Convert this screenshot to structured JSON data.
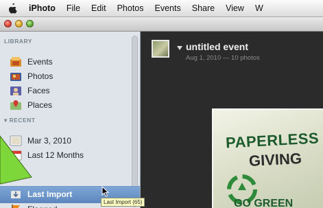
{
  "menubar": {
    "app": "iPhoto",
    "items": [
      "File",
      "Edit",
      "Photos",
      "Events",
      "Share",
      "View",
      "W"
    ]
  },
  "sidebar": {
    "library_label": "LIBRARY",
    "library_items": [
      "Events",
      "Photos",
      "Faces",
      "Places"
    ],
    "recent_label": "▾ RECENT",
    "recent_items": [
      "Mar 3, 2010",
      "Last 12 Months",
      "Last Import",
      "Flagged"
    ],
    "selected_item": "Last Import"
  },
  "event": {
    "title": "untitled event",
    "subtitle": "Aug 1, 2010 — 10 photos"
  },
  "photo": {
    "line1": "PAPERLESS",
    "line2": "GIVING",
    "line3": "GO GREEN"
  },
  "tooltip": "Last Import (65)",
  "colors": {
    "selection": "#6b92c8",
    "callout": "#7dd63a",
    "sidebar_bg": "#dfe4ea"
  }
}
